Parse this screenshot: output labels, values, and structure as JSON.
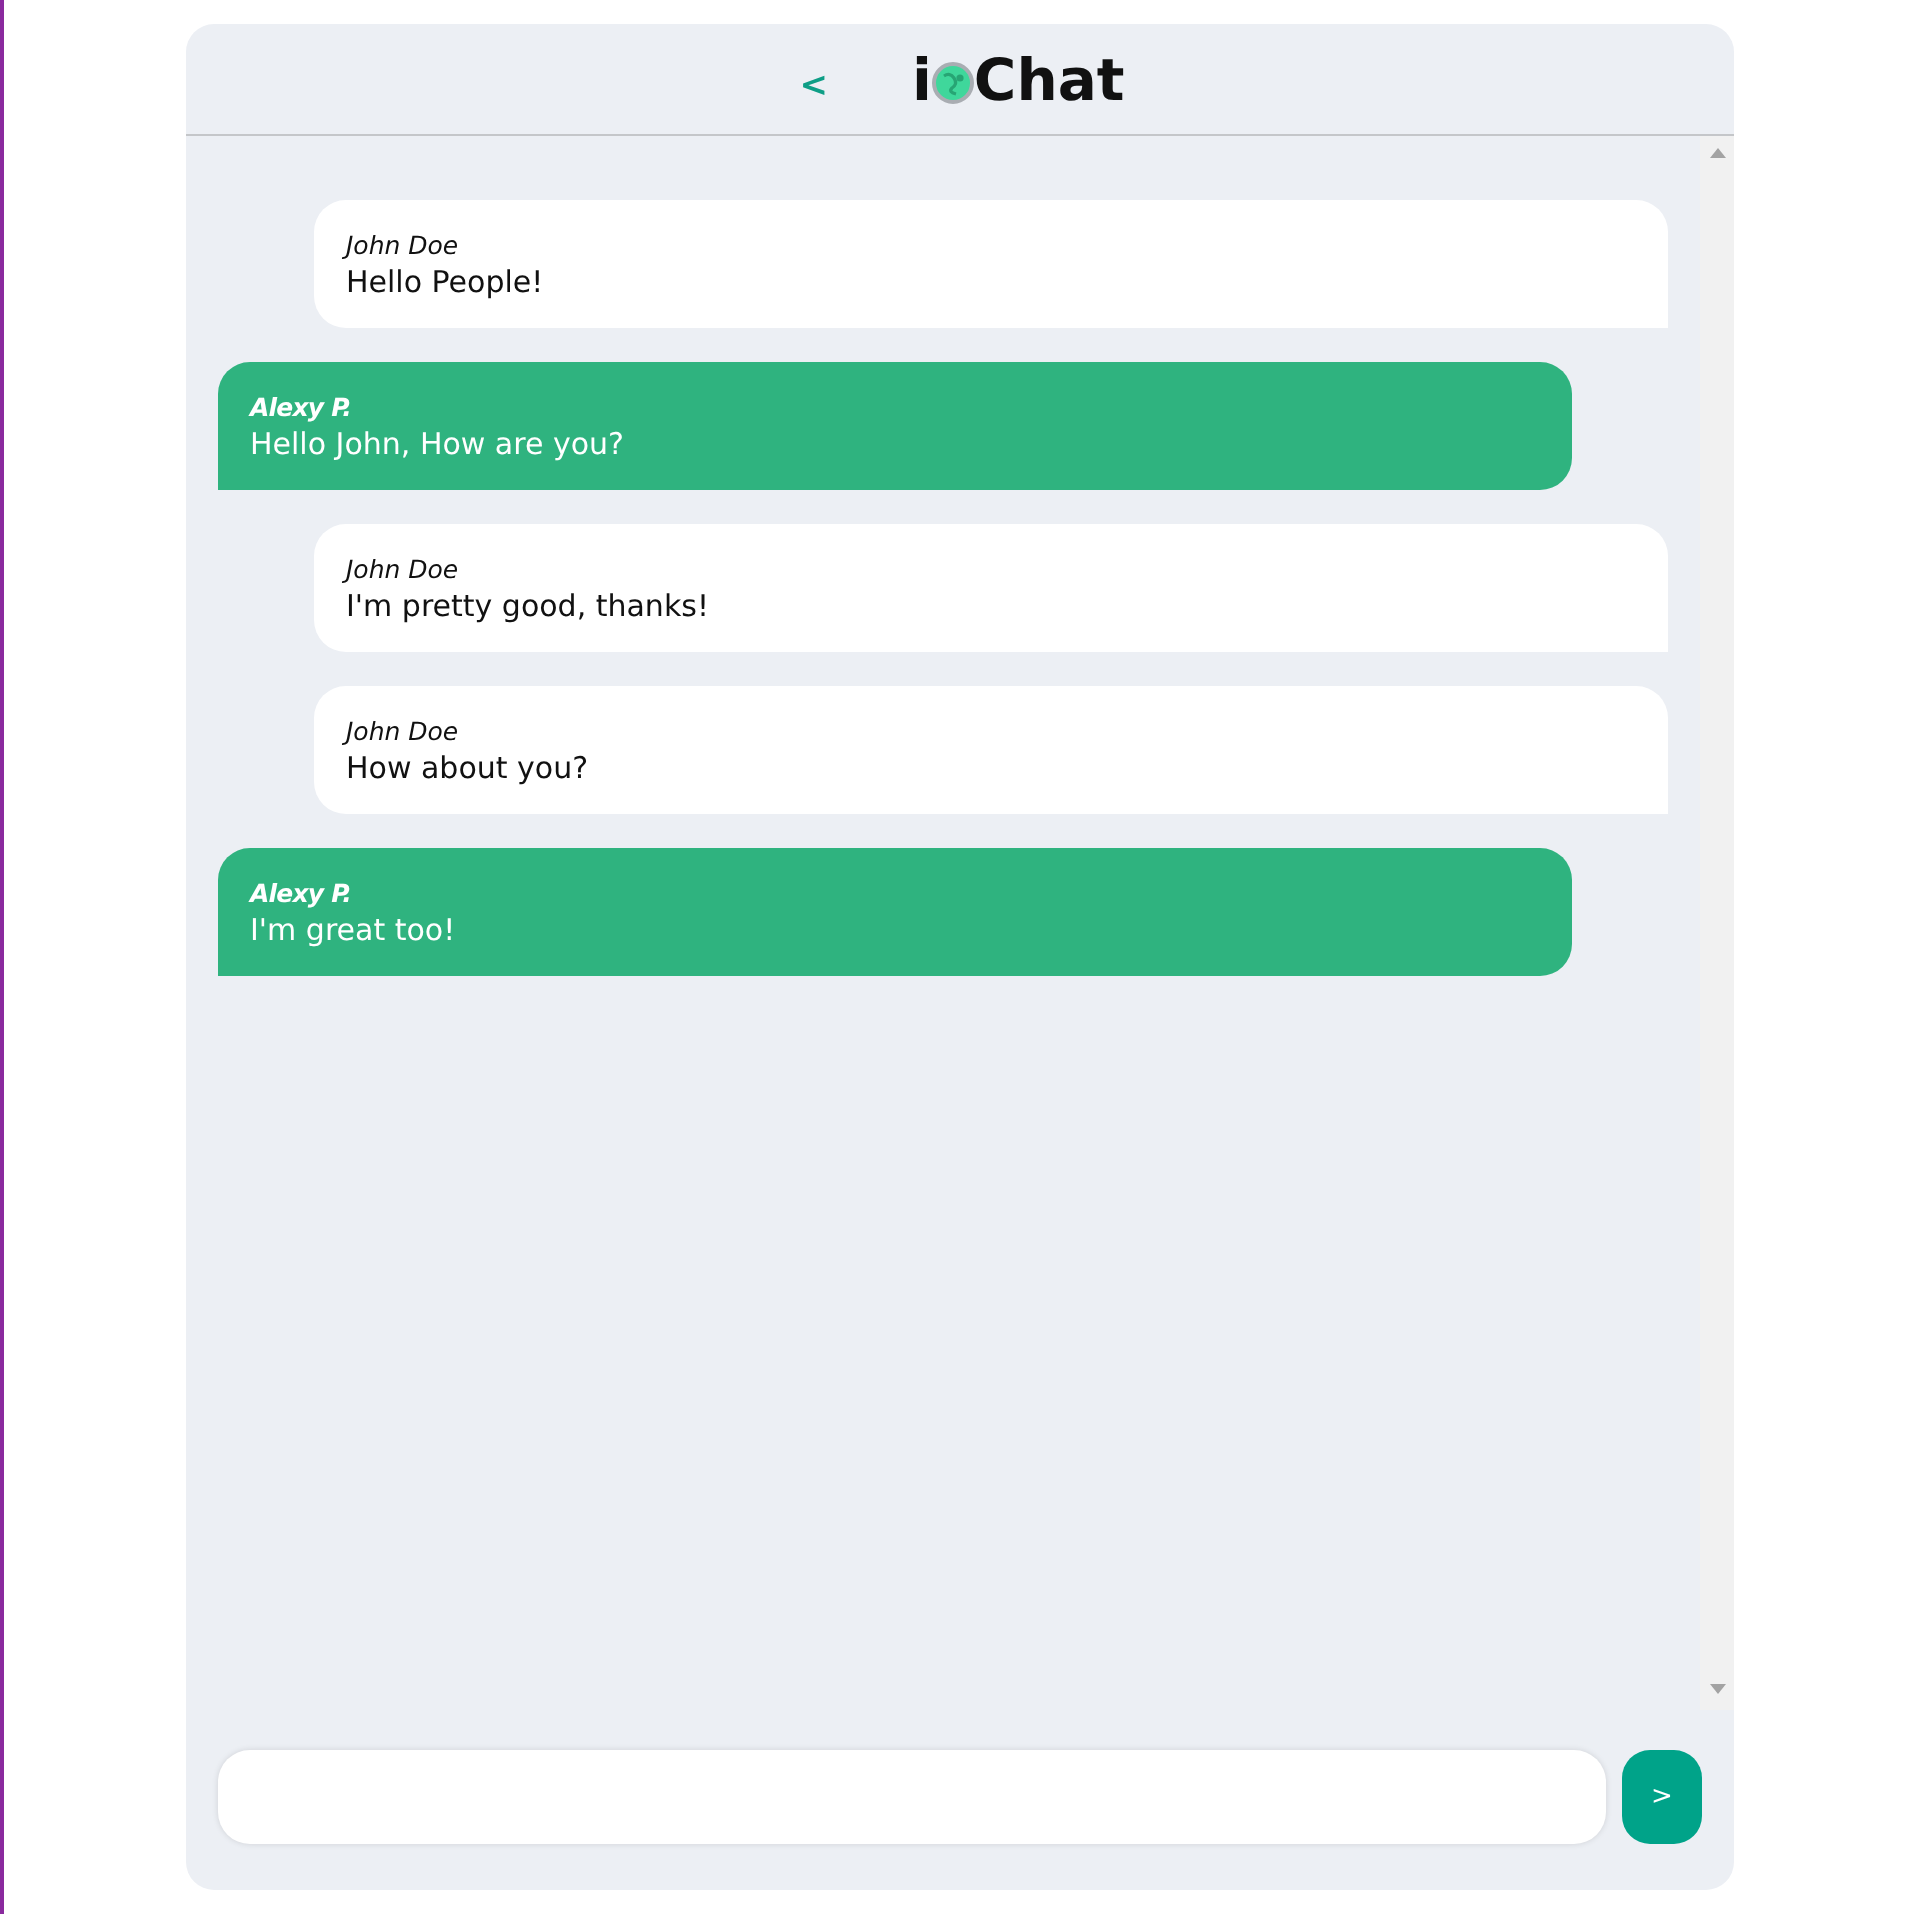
{
  "header": {
    "back": "<",
    "title_start": "i",
    "title_end": "Chat"
  },
  "messages": [
    {
      "kind": "sent",
      "sender": "John Doe",
      "text": "Hello People!"
    },
    {
      "kind": "received",
      "sender": "Alexy P.",
      "text": "Hello John, How are you?"
    },
    {
      "kind": "sent",
      "sender": "John Doe",
      "text": "I'm pretty good, thanks!"
    },
    {
      "kind": "sent",
      "sender": "John Doe",
      "text": "How about you?"
    },
    {
      "kind": "received",
      "sender": "Alexy P.",
      "text": "I'm great too!"
    }
  ],
  "composer": {
    "send": ">"
  }
}
